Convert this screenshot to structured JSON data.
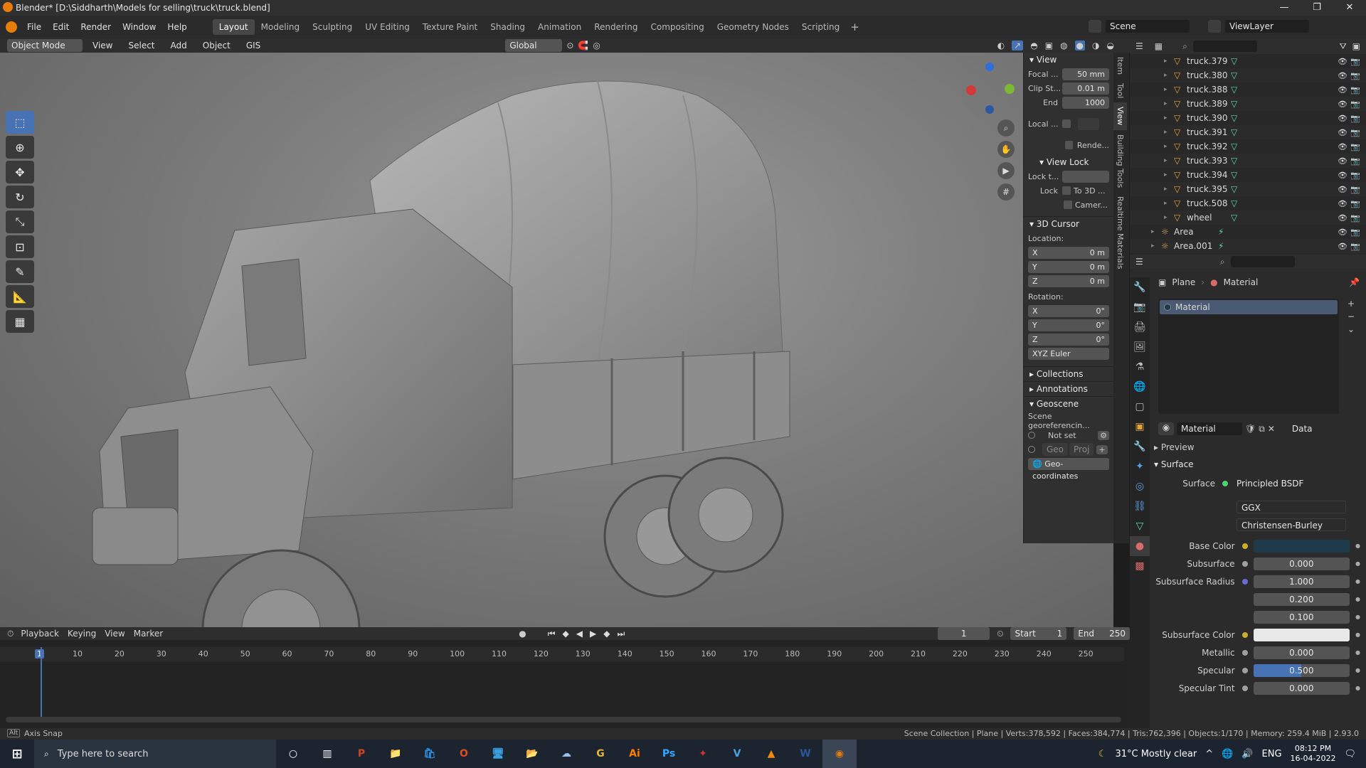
{
  "title_bar": {
    "title": "Blender* [D:\\Siddharth\\Models for selling\\truck\\truck.blend]",
    "minimize": "—",
    "maximize": "❐",
    "close": "✕"
  },
  "menu": {
    "items": [
      "File",
      "Edit",
      "Render",
      "Window",
      "Help"
    ]
  },
  "workspaces": {
    "tabs": [
      "Layout",
      "Modeling",
      "Sculpting",
      "UV Editing",
      "Texture Paint",
      "Shading",
      "Animation",
      "Rendering",
      "Compositing",
      "Geometry Nodes",
      "Scripting"
    ],
    "active": "Layout",
    "add": "+"
  },
  "scene": {
    "label": "Scene",
    "view_layer": "ViewLayer"
  },
  "viewport_header": {
    "mode": "Object Mode",
    "view": "View",
    "select": "Select",
    "add": "Add",
    "object": "Object",
    "gis": "GIS",
    "orientation": "Global"
  },
  "toolbar": {
    "tools": [
      "select-box",
      "cursor",
      "move",
      "rotate",
      "scale",
      "transform",
      "annotate",
      "measure",
      "add-cube"
    ],
    "active": "select-box"
  },
  "n_panel": {
    "tabs": [
      "Item",
      "Tool",
      "View",
      "Building Tools",
      "Realtime Materials"
    ],
    "view_section": "View",
    "focal_label": "Focal ...",
    "focal_value": "50 mm",
    "clip_start_label": "Clip St...",
    "clip_start_value": "0.01 m",
    "end_label": "End",
    "end_value": "1000",
    "local_label": "Local ...",
    "render_label": "Rende...",
    "view_lock": "View Lock",
    "lock_to_label": "Lock t...",
    "lock_label": "Lock",
    "to3d": "To 3D ...",
    "camera": "Camer...",
    "cursor_section": "3D Cursor",
    "location": "Location:",
    "loc": [
      {
        "axis": "X",
        "value": "0 m"
      },
      {
        "axis": "Y",
        "value": "0 m"
      },
      {
        "axis": "Z",
        "value": "0 m"
      }
    ],
    "rotation": "Rotation:",
    "rot": [
      {
        "axis": "X",
        "value": "0°"
      },
      {
        "axis": "Y",
        "value": "0°"
      },
      {
        "axis": "Z",
        "value": "0°"
      }
    ],
    "rot_mode": "XYZ Euler",
    "collections": "Collections",
    "annotations": "Annotations",
    "geoscene": "Geoscene",
    "georef": "Scene georeferencin...",
    "not_set": "Not set",
    "geo": "Geo",
    "proj": "Proj",
    "geo_coords": "Geo-coordinates"
  },
  "outliner": {
    "rows": [
      {
        "name": "truck.379",
        "type": "mesh"
      },
      {
        "name": "truck.380",
        "type": "mesh"
      },
      {
        "name": "truck.388",
        "type": "mesh"
      },
      {
        "name": "truck.389",
        "type": "mesh"
      },
      {
        "name": "truck.390",
        "type": "mesh"
      },
      {
        "name": "truck.391",
        "type": "mesh"
      },
      {
        "name": "truck.392",
        "type": "mesh"
      },
      {
        "name": "truck.393",
        "type": "mesh"
      },
      {
        "name": "truck.394",
        "type": "mesh"
      },
      {
        "name": "truck.395",
        "type": "mesh"
      },
      {
        "name": "truck.508",
        "type": "mesh"
      },
      {
        "name": "wheel",
        "type": "mesh"
      },
      {
        "name": "Area",
        "type": "light"
      },
      {
        "name": "Area.001",
        "type": "light"
      }
    ]
  },
  "properties": {
    "breadcrumb_obj": "Plane",
    "breadcrumb_mat": "Material",
    "slot": "Material",
    "mat_name": "Material",
    "link": "Data",
    "preview": "Preview",
    "surface_section": "Surface",
    "surface_label": "Surface",
    "surface_value": "Principled BSDF",
    "distribution": "GGX",
    "ss_method": "Christensen-Burley",
    "rows": [
      {
        "label": "Base Color",
        "value": "",
        "kind": "color",
        "color": "#1d3b4a",
        "dot": "#c8b02a"
      },
      {
        "label": "Subsurface",
        "value": "0.000",
        "kind": "num",
        "dot": "#a0a0a0"
      },
      {
        "label": "Subsurface Radius",
        "value": "1.000",
        "kind": "num",
        "dot": "#6b6bd8"
      },
      {
        "label": "",
        "value": "0.200",
        "kind": "num",
        "dot": ""
      },
      {
        "label": "",
        "value": "0.100",
        "kind": "num",
        "dot": ""
      },
      {
        "label": "Subsurface Color",
        "value": "",
        "kind": "color",
        "color": "#e8e8e8",
        "dot": "#c8b02a"
      },
      {
        "label": "Metallic",
        "value": "0.000",
        "kind": "num",
        "dot": "#a0a0a0"
      },
      {
        "label": "Specular",
        "value": "0.500",
        "kind": "slider",
        "fraction": 0.5,
        "dot": "#a0a0a0"
      },
      {
        "label": "Specular Tint",
        "value": "0.000",
        "kind": "num",
        "dot": "#a0a0a0"
      }
    ]
  },
  "timeline": {
    "menus": [
      "Playback",
      "Keying",
      "View",
      "Marker"
    ],
    "current_frame": "1",
    "start_label": "Start",
    "start": "1",
    "end_label": "End",
    "end": "250",
    "ticks": [
      "1",
      "10",
      "20",
      "30",
      "40",
      "50",
      "60",
      "70",
      "80",
      "90",
      "100",
      "110",
      "120",
      "130",
      "140",
      "150",
      "160",
      "170",
      "180",
      "190",
      "200",
      "210",
      "220",
      "230",
      "240",
      "250"
    ]
  },
  "statusbar": {
    "left": "Axis Snap",
    "right": "Scene Collection | Plane | Verts:378,592 | Faces:384,774 | Tris:762,396 | Objects:1/170 | Memory: 259.4 MiB | 2.93.0"
  },
  "taskbar": {
    "search_placeholder": "Type here to search",
    "apps": [
      "P",
      "📁",
      "🛍",
      "O",
      "🖥",
      "📂",
      "☁",
      "G",
      "Ai",
      "Ps",
      "✦",
      "V",
      "▲",
      "W",
      "◉"
    ],
    "weather": "31°C  Mostly clear",
    "lang": "ENG",
    "time": "08:12 PM",
    "date": "16-04-2022"
  },
  "colors": {
    "accent": "#4772b3",
    "mesh_icon": "#e5a13a",
    "data_icon": "#5fd6a8",
    "light_icon": "#e0b060"
  }
}
